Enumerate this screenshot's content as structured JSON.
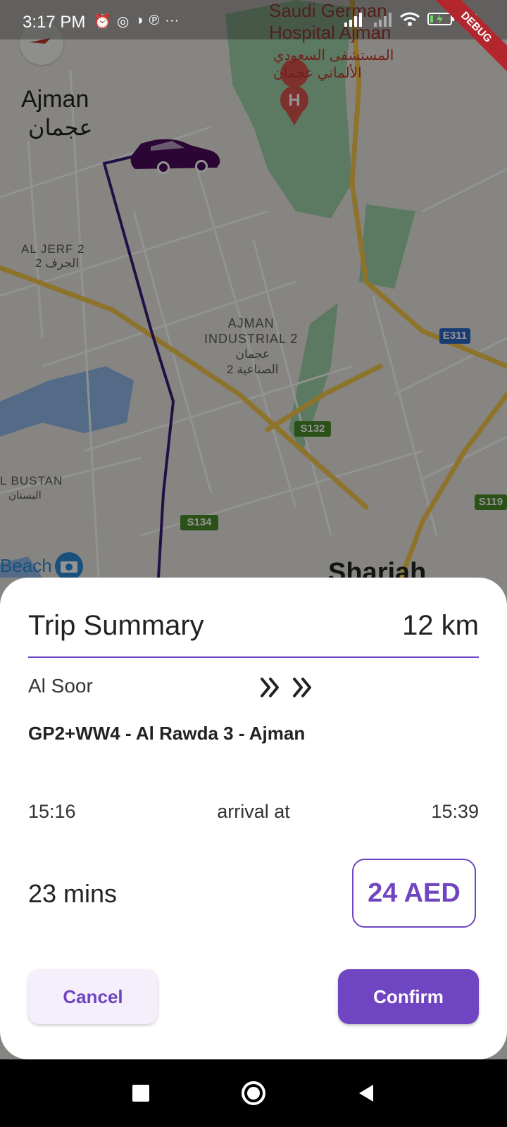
{
  "status_bar": {
    "time": "3:17 PM",
    "battery": "4%",
    "debug_banner": "DEBUG"
  },
  "map": {
    "labels": {
      "hospital": "Saudi German\nHospital Ajman",
      "hospital_ar": "المستشفى السعودي\nالألماني عجمان",
      "ajman": "Ajman",
      "ajman_ar": "عجمان",
      "al_jerf": "AL JERF 2",
      "al_jerf_ar": "2 الجرف",
      "industrial": "AJMAN\nINDUSTRIAL 2",
      "industrial_ar": "عجمان\nالصناعية 2",
      "al_bustan": "L BUSTAN",
      "al_bustan_ar": "البستان",
      "beach": "Beach",
      "sharjah": "Sharjah",
      "shield_e311": "E311",
      "shield_s132": "S132",
      "shield_s134": "S134",
      "shield_s119": "S119"
    },
    "route_color": "#3a1a78",
    "car_color": "#4a0a5a"
  },
  "trip_summary": {
    "title": "Trip Summary",
    "distance": "12 km",
    "from": "Al Soor",
    "destination": "GP2+WW4 - Al Rawda 3 - Ajman",
    "start_time": "15:16",
    "arrival_label": "arrival at",
    "arrival_time": "15:39",
    "duration": "23 mins",
    "fare": "24 AED",
    "cancel_label": "Cancel",
    "confirm_label": "Confirm",
    "accent_color": "#6f45c1"
  },
  "nav_bar": {
    "icons": [
      "recents-icon",
      "home-icon",
      "back-icon"
    ]
  }
}
